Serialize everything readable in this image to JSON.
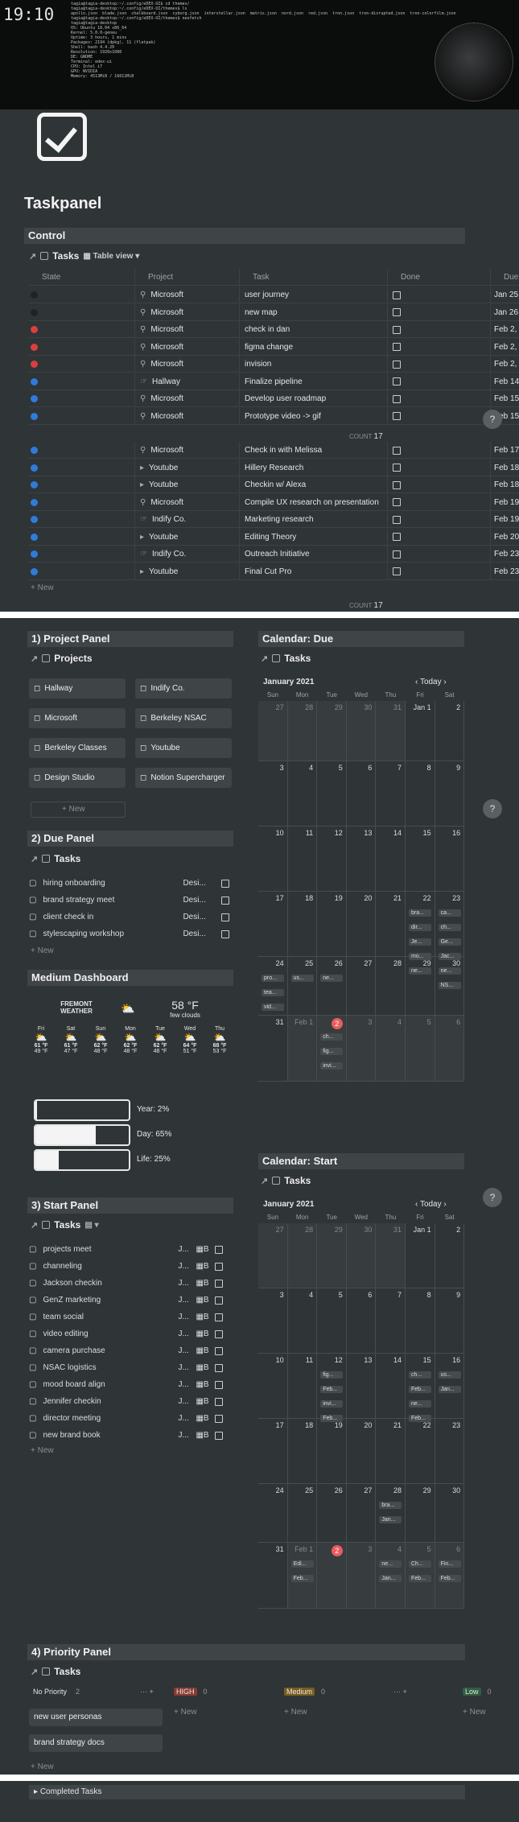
{
  "terminal": {
    "clock": "19:10",
    "lines": [
      "tagia@tagia-desktop:~/.config/eDEX-UI$ cd themes/",
      "tagia@tagia-desktop:~/.config/eDEX-UI/themes$ ls",
      "apollo.json  blade.json  chalkboard.json  cyborg.json  interstellar.json  matrix.json  nord.json  red.json  tron.json  tron-disrupted.json  tron-colorfilm.json",
      "tagia@tagia-desktop:~/.config/eDEX-UI/themes$ neofetch",
      "tagia@tagia-desktop",
      "OS: Ubuntu 18.04 x86_64",
      "Kernel: 5.0.0-geneu",
      "Uptime: 3 hours, 1 mins",
      "Packages: 2194 (dpkg), 11 (flatpak)",
      "Shell: bash 4.4.20",
      "Resolution: 1920x1080",
      "DE: GNOME",
      "Terminal: edex-ui",
      "CPU: Intel i7",
      "GPU: NVIDIA",
      "Memory: 4513MiB / 16011MiB"
    ]
  },
  "page": {
    "title": "Taskpanel"
  },
  "control": {
    "header": "Control",
    "db_title": "Tasks",
    "view": "Table view",
    "columns": [
      "State",
      "Project",
      "Task",
      "Done",
      "Due"
    ],
    "rows": [
      {
        "state": "#222222",
        "project": "Microsoft",
        "ptype": "search",
        "task": "user journey",
        "due": "Jan 25"
      },
      {
        "state": "#222222",
        "project": "Microsoft",
        "ptype": "search",
        "task": "new map",
        "due": "Jan 26"
      },
      {
        "state": "#d93f3f",
        "project": "Microsoft",
        "ptype": "search",
        "task": "check in dan",
        "due": "Feb 2,"
      },
      {
        "state": "#d93f3f",
        "project": "Microsoft",
        "ptype": "search",
        "task": "figma change",
        "due": "Feb 2,"
      },
      {
        "state": "#d93f3f",
        "project": "Microsoft",
        "ptype": "search",
        "task": "invision",
        "due": "Feb 2,"
      },
      {
        "state": "#2f7bd9",
        "project": "Hallway",
        "ptype": "box",
        "task": "Finalize pipeline",
        "due": "Feb 14"
      },
      {
        "state": "#2f7bd9",
        "project": "Microsoft",
        "ptype": "search",
        "task": "Develop user roadmap",
        "due": "Feb 15"
      },
      {
        "state": "#2f7bd9",
        "project": "Microsoft",
        "ptype": "search",
        "task": "Prototype video -> gif",
        "due": "Feb 15"
      }
    ],
    "rows2": [
      {
        "state": "#2f7bd9",
        "project": "Microsoft",
        "ptype": "search",
        "task": "Check in with Melissa",
        "due": "Feb 17"
      },
      {
        "state": "#2f7bd9",
        "project": "Youtube",
        "ptype": "play",
        "task": "Hillery Research",
        "due": "Feb 18"
      },
      {
        "state": "#2f7bd9",
        "project": "Youtube",
        "ptype": "play",
        "task": "Checkin w/ Alexa",
        "due": "Feb 18"
      },
      {
        "state": "#2f7bd9",
        "project": "Microsoft",
        "ptype": "search",
        "task": "Compile UX research on presentation",
        "due": "Feb 19"
      },
      {
        "state": "#2f7bd9",
        "project": "Indify Co.",
        "ptype": "hand",
        "task": "Marketing research",
        "due": "Feb 19"
      },
      {
        "state": "#2f7bd9",
        "project": "Youtube",
        "ptype": "play",
        "task": "Editing Theory",
        "due": "Feb 20"
      },
      {
        "state": "#2f7bd9",
        "project": "Indify Co.",
        "ptype": "hand",
        "task": "Outreach Initiative",
        "due": "Feb 23"
      },
      {
        "state": "#2f7bd9",
        "project": "Youtube",
        "ptype": "play",
        "task": "Final Cut Pro",
        "due": "Feb 23"
      }
    ],
    "count_label": "COUNT",
    "count1": "17",
    "count2": "17",
    "new_label": "New"
  },
  "project_panel": {
    "header": "1) Project Panel",
    "db_title": "Projects",
    "items": [
      "Hallway",
      "Indify Co.",
      "Microsoft",
      "Berkeley NSAC",
      "Berkeley Classes",
      "Youtube",
      "Design Studio",
      "Notion Supercharger"
    ],
    "new_label": "New"
  },
  "due_panel": {
    "header": "2) Due Panel",
    "db_title": "Tasks",
    "items": [
      {
        "name": "hiring onboarding",
        "proj": "Desi..."
      },
      {
        "name": "brand strategy meet",
        "proj": "Desi..."
      },
      {
        "name": "client check in",
        "proj": "Desi..."
      },
      {
        "name": "stylescaping workshop",
        "proj": "Desi..."
      }
    ],
    "new_label": "New"
  },
  "dashboard": {
    "header": "Medium Dashboard",
    "city": "FREMONT",
    "city2": "WEATHER",
    "temp": "58 °F",
    "cond": "few clouds",
    "days": [
      {
        "d": "Fri",
        "hi": "61 °F",
        "lo": "49 °F"
      },
      {
        "d": "Sat",
        "hi": "61 °F",
        "lo": "47 °F"
      },
      {
        "d": "Sun",
        "hi": "62 °F",
        "lo": "48 °F"
      },
      {
        "d": "Mon",
        "hi": "62 °F",
        "lo": "48 °F"
      },
      {
        "d": "Tue",
        "hi": "62 °F",
        "lo": "48 °F"
      },
      {
        "d": "Wed",
        "hi": "64 °F",
        "lo": "51 °F"
      },
      {
        "d": "Thu",
        "hi": "68 °F",
        "lo": "53 °F"
      }
    ],
    "bars": [
      {
        "label": "Year: 2%",
        "value": 0.02
      },
      {
        "label": "Day: 65%",
        "value": 0.65
      },
      {
        "label": "Life: 25%",
        "value": 0.25
      }
    ]
  },
  "start_panel": {
    "header": "3) Start Panel",
    "db_title": "Tasks",
    "items": [
      "projects meet",
      "channeling",
      "Jackson checkin",
      "GenZ marketing",
      "team social",
      "video editing",
      "camera purchase",
      "NSAC logistics",
      "mood board align",
      "Jennifer checkin",
      "director meeting",
      "new brand book"
    ],
    "col_j": "J...",
    "col_b": "B",
    "new_label": "New"
  },
  "cal_due": {
    "header": "Calendar: Due",
    "db_title": "Tasks",
    "month": "January 2021",
    "today": "Today",
    "dow": [
      "Sun",
      "Mon",
      "Tue",
      "Wed",
      "Thu",
      "Fri",
      "Sat"
    ],
    "weeks": [
      [
        "27",
        "28",
        "29",
        "30",
        "31",
        "Jan 1",
        "2"
      ],
      [
        "3",
        "4",
        "5",
        "6",
        "7",
        "8",
        "9"
      ],
      [
        "10",
        "11",
        "12",
        "13",
        "14",
        "15",
        "16"
      ],
      [
        "17",
        "18",
        "19",
        "20",
        "21",
        "22",
        "23"
      ],
      [
        "24",
        "25",
        "26",
        "27",
        "28",
        "29",
        "30"
      ],
      [
        "31",
        "Feb 1",
        "2",
        "3",
        "4",
        "5",
        "6"
      ]
    ],
    "events": [
      {
        "w": 3,
        "d": 5,
        "items": [
          "bra...",
          "dir...",
          "Je...",
          "mo...",
          "ne..."
        ]
      },
      {
        "w": 3,
        "d": 6,
        "items": [
          "ca...",
          "ch...",
          "Ge...",
          "Jac...",
          "ne...",
          "NS..."
        ]
      },
      {
        "w": 4,
        "d": 0,
        "items": [
          "pro...",
          "tea...",
          "vid..."
        ]
      },
      {
        "w": 4,
        "d": 1,
        "items": [
          "us..."
        ]
      },
      {
        "w": 4,
        "d": 2,
        "items": [
          "ne..."
        ]
      },
      {
        "w": 5,
        "d": 2,
        "items": [
          "ch...",
          "fig...",
          "invi..."
        ]
      }
    ]
  },
  "cal_start": {
    "header": "Calendar: Start",
    "db_title": "Tasks",
    "month": "January 2021",
    "today": "Today",
    "dow": [
      "Sun",
      "Mon",
      "Tue",
      "Wed",
      "Thu",
      "Fri",
      "Sat"
    ],
    "weeks": [
      [
        "27",
        "28",
        "29",
        "30",
        "31",
        "Jan 1",
        "2"
      ],
      [
        "3",
        "4",
        "5",
        "6",
        "7",
        "8",
        "9"
      ],
      [
        "10",
        "11",
        "12",
        "13",
        "14",
        "15",
        "16"
      ],
      [
        "17",
        "18",
        "19",
        "20",
        "21",
        "22",
        "23"
      ],
      [
        "24",
        "25",
        "26",
        "27",
        "28",
        "29",
        "30"
      ],
      [
        "31",
        "Feb 1",
        "2",
        "3",
        "4",
        "5",
        "6"
      ]
    ],
    "events": [
      {
        "w": 2,
        "d": 2,
        "items": [
          "fig...",
          "Feb...",
          "invi...",
          "Feb..."
        ]
      },
      {
        "w": 2,
        "d": 5,
        "items": [
          "ch...",
          "Feb...",
          "ne...",
          "Feb..."
        ]
      },
      {
        "w": 2,
        "d": 6,
        "items": [
          "us...",
          "Jan..."
        ]
      },
      {
        "w": 4,
        "d": 4,
        "items": [
          "bra...",
          "Jan..."
        ]
      },
      {
        "w": 5,
        "d": 1,
        "items": [
          "Edi...",
          "Feb..."
        ]
      },
      {
        "w": 5,
        "d": 4,
        "items": [
          "ne...",
          "Jan..."
        ]
      },
      {
        "w": 5,
        "d": 5,
        "items": [
          "Ch...",
          "Feb..."
        ]
      },
      {
        "w": 5,
        "d": 6,
        "items": [
          "Fin...",
          "Feb..."
        ]
      }
    ]
  },
  "priority": {
    "header": "4) Priority Panel",
    "db_title": "Tasks",
    "groups": [
      {
        "label": "No Priority",
        "count": "2"
      },
      {
        "label": "HIGH",
        "count": "0",
        "color": "#8a3a30"
      },
      {
        "label": "Medium",
        "count": "0",
        "color": "#7a5e20"
      },
      {
        "label": "Low",
        "count": "0",
        "color": "#2f5e3f"
      }
    ],
    "cards": [
      "new user personas",
      "brand strategy docs"
    ],
    "new_label": "New"
  },
  "completed": {
    "label": "Completed Tasks"
  }
}
